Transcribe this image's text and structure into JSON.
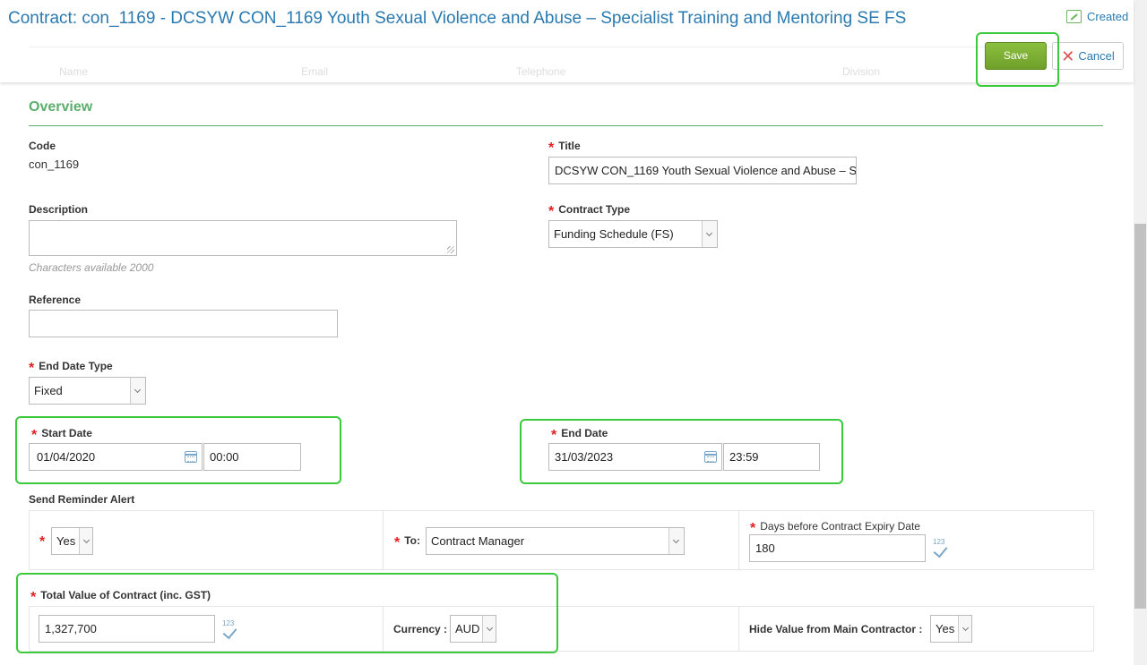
{
  "header": {
    "title": "Contract: con_1169 - DCSYW CON_1169 Youth Sexual Violence and Abuse – Specialist Training and Mentoring SE FS",
    "status": "Created",
    "save_label": "Save",
    "cancel_label": "Cancel"
  },
  "ghost_columns": [
    "Name",
    "Email",
    "Telephone",
    "Division"
  ],
  "overview": {
    "section_title": "Overview",
    "code_label": "Code",
    "code_value": "con_1169",
    "title_label": "Title",
    "title_value": "DCSYW CON_1169 Youth Sexual Violence and Abuse – Specialist Training and Mentoring SE FS",
    "description_label": "Description",
    "description_value": "",
    "chars_hint": "Characters available 2000",
    "contract_type_label": "Contract Type",
    "contract_type_value": "Funding Schedule (FS)",
    "reference_label": "Reference",
    "reference_value": "",
    "end_date_type_label": "End Date Type",
    "end_date_type_value": "Fixed",
    "start_date_label": "Start Date",
    "start_date_value": "01/04/2020",
    "start_time_value": "00:00",
    "end_date_label": "End Date",
    "end_date_value": "31/03/2023",
    "end_time_value": "23:59"
  },
  "reminder": {
    "section_label": "Send Reminder Alert",
    "enabled_value": "Yes",
    "to_label": "To:",
    "to_value": "Contract Manager",
    "days_label": "Days before Contract Expiry Date",
    "days_value": "180"
  },
  "value": {
    "total_label": "Total Value of Contract (inc. GST)",
    "total_value": "1,327,700",
    "currency_label": "Currency :",
    "currency_value": "AUD",
    "hide_label": "Hide Value from Main Contractor :",
    "hide_value": "Yes"
  },
  "num_icon_text": "123",
  "colors": {
    "accent": "#2a7ab0",
    "section": "#5cae6c",
    "save": "#7aab32",
    "required": "#e02020",
    "highlight": "#3dc93d"
  }
}
